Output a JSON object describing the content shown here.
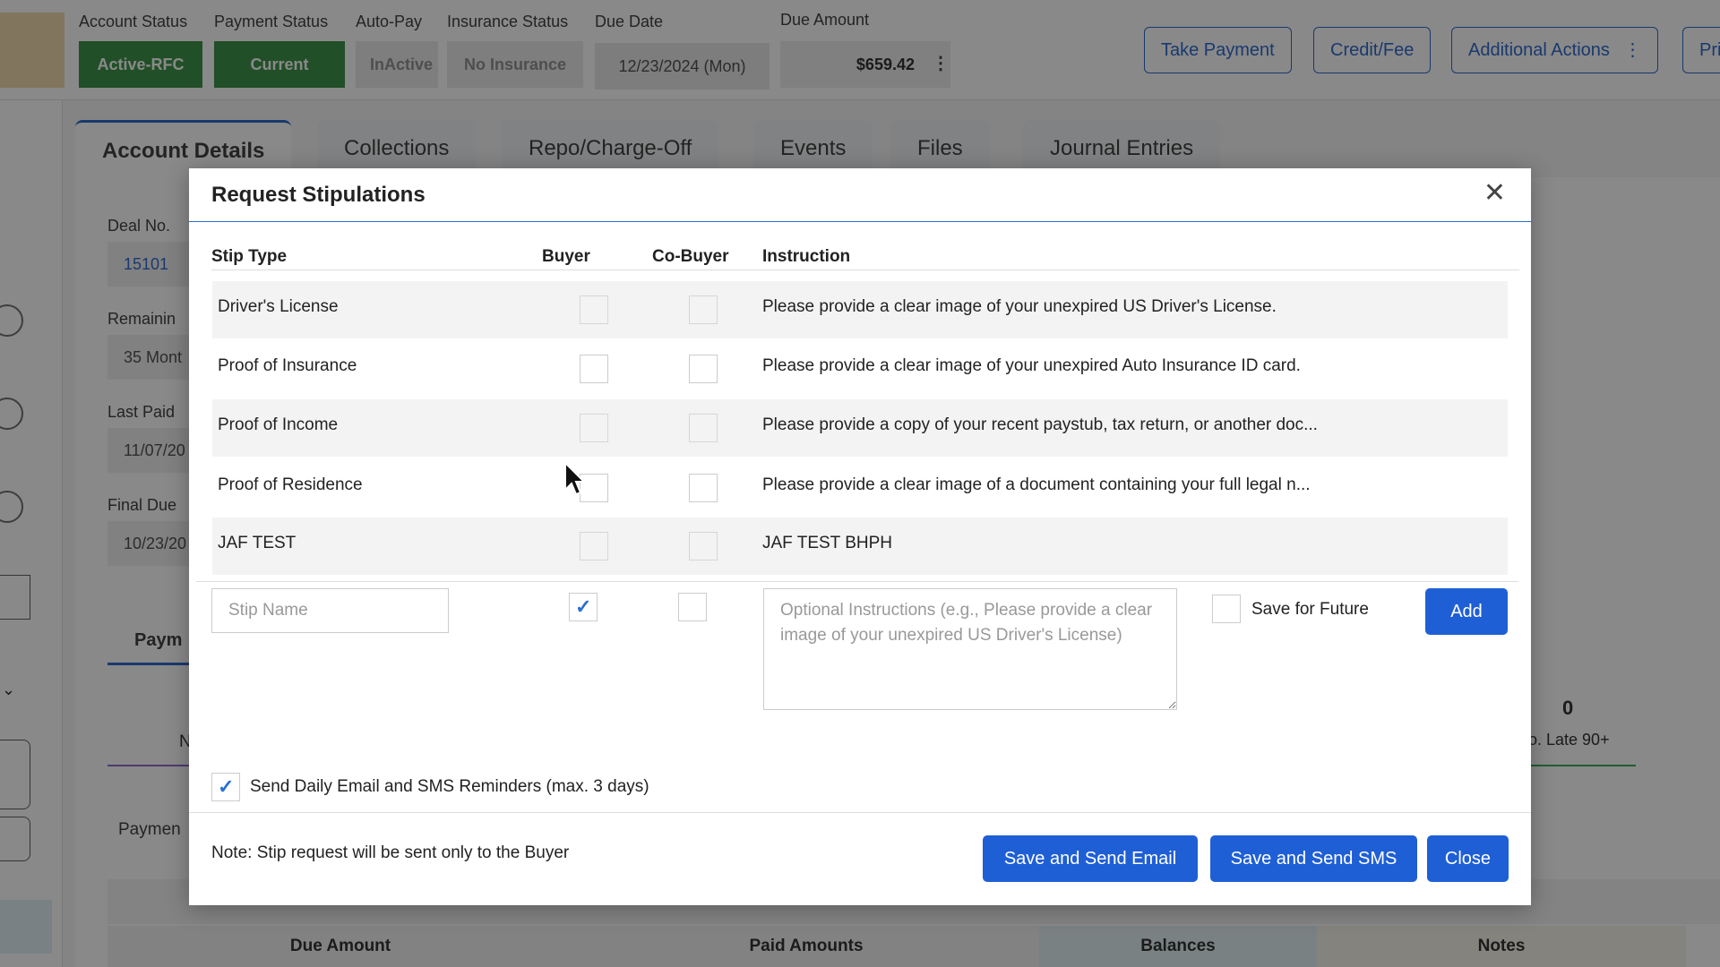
{
  "header": {
    "labels": {
      "account_status": "Account Status",
      "payment_status": "Payment Status",
      "auto_pay": "Auto-Pay",
      "insurance_status": "Insurance Status",
      "due_date": "Due Date",
      "due_amount": "Due Amount"
    },
    "values": {
      "account_status": "Active-RFC",
      "payment_status": "Current",
      "auto_pay": "InActive",
      "insurance_status": "No Insurance",
      "due_date": "12/23/2024 (Mon)",
      "due_amount": "$659.42"
    },
    "buttons": {
      "take_payment": "Take Payment",
      "credit_fee": "Credit/Fee",
      "additional_actions": "Additional Actions",
      "print": "Pri"
    }
  },
  "tabs": [
    "Account Details",
    "Collections",
    "Repo/Charge-Off",
    "Events",
    "Files",
    "Journal Entries"
  ],
  "account_fields": {
    "deal_no_label": "Deal No.",
    "deal_no": "15101",
    "remaining_label": "Remainin",
    "remaining": "35 Mont",
    "last_paid_label": "Last Paid",
    "last_paid": "11/07/20",
    "final_due_label": "Final Due",
    "final_due": "10/23/20"
  },
  "payments_tab": "Paym",
  "late_90": {
    "value": "0",
    "label": "o. Late 90+"
  },
  "payment_label": "Paymen",
  "bg_n": "N",
  "grid_headers": [
    "Due Amount",
    "Paid Amounts",
    "Balances",
    "Notes"
  ],
  "modal": {
    "title": "Request Stipulations",
    "close_icon": "close-icon",
    "columns": {
      "stip_type": "Stip Type",
      "buyer": "Buyer",
      "co_buyer": "Co-Buyer",
      "instruction": "Instruction"
    },
    "rows": [
      {
        "name": "Driver's License",
        "instruction": "Please provide a clear image of your unexpired US Driver's License."
      },
      {
        "name": "Proof of Insurance",
        "instruction": "Please provide a clear image of your unexpired Auto Insurance ID card."
      },
      {
        "name": "Proof of Income",
        "instruction": "Please provide a copy of your recent paystub, tax return, or another doc..."
      },
      {
        "name": "Proof of Residence",
        "instruction": "Please provide a clear image of a document containing your full legal n..."
      },
      {
        "name": "JAF TEST",
        "instruction": "JAF TEST BHPH"
      }
    ],
    "new_stip": {
      "name_placeholder": "Stip Name",
      "buyer_checked": true,
      "co_buyer_checked": false,
      "instructions_placeholder": "Optional Instructions (e.g., Please provide a clear image of your unexpired US Driver's License)",
      "save_for_future_label": "Save for Future",
      "add_label": "Add"
    },
    "reminder_label": "Send Daily Email and SMS Reminders (max. 3 days)",
    "reminder_checked": true,
    "note": "Note: Stip request will be sent only to the Buyer",
    "buttons": {
      "save_email": "Save and Send Email",
      "save_sms": "Save and Send SMS",
      "close": "Close"
    }
  },
  "colors": {
    "primary": "#1f5fd6",
    "active_green": "#2e8b3a",
    "accent_border": "#2a6fcf"
  }
}
